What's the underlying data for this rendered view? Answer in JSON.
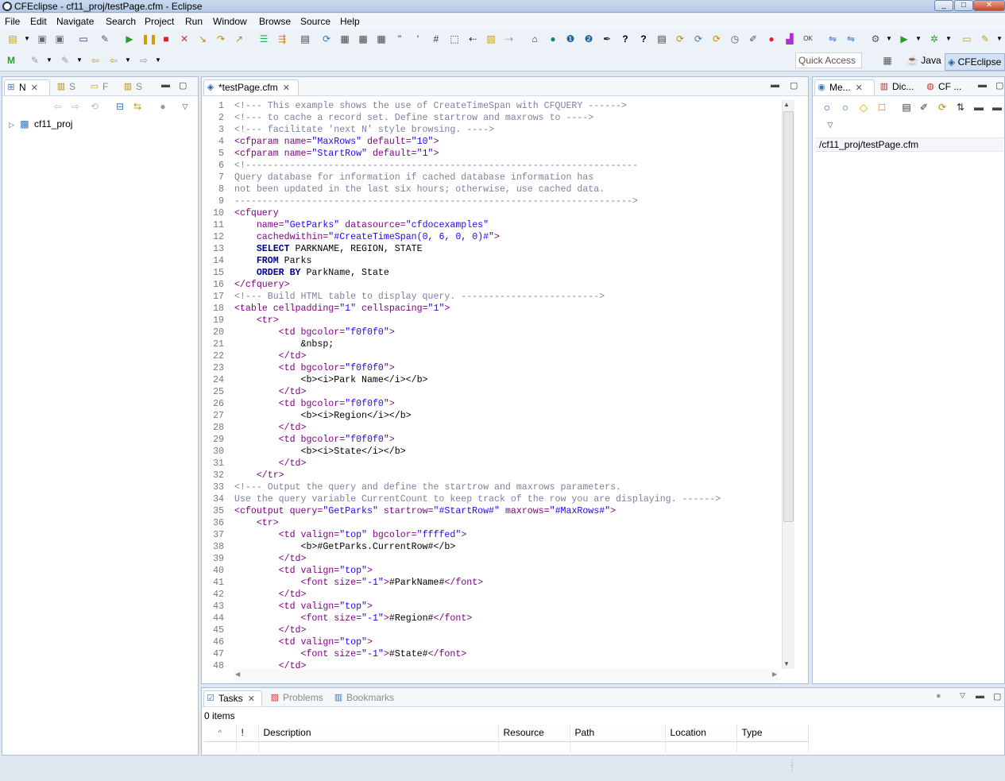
{
  "window": {
    "title": "CFEclipse - cf11_proj/testPage.cfm - Eclipse",
    "min": "_",
    "max": "□",
    "close": "✕"
  },
  "menu": [
    "File",
    "Edit",
    "Navigate",
    "Search",
    "Project",
    "Run",
    "Window",
    "Browse",
    "Source",
    "Help"
  ],
  "quick_access": {
    "placeholder": "Quick Access"
  },
  "perspectives": {
    "java": "Java",
    "cfeclipse": "CFEclipse"
  },
  "left_panel": {
    "tabs": [
      {
        "label": "N",
        "icon": "navigator-icon"
      },
      {
        "label": "S",
        "icon": "library-icon"
      },
      {
        "label": "F",
        "icon": "folder-icon"
      },
      {
        "label": "S",
        "icon": "library-icon"
      }
    ],
    "tree": [
      {
        "label": "cf11_proj",
        "icon": "project-icon"
      }
    ]
  },
  "editor": {
    "tab_label": "*testPage.cfm",
    "lines": [
      [
        [
          "cm",
          "<!--- This example shows the use of CreateTimeSpan with CFQUERY ------>"
        ]
      ],
      [
        [
          "cm",
          "<!--- to cache a record set. Define startrow and maxrows to ---->"
        ]
      ],
      [
        [
          "cm",
          "<!--- facilitate 'next N' style browsing. ---->"
        ]
      ],
      [
        [
          "tg",
          "<cfparam "
        ],
        [
          "at",
          "name="
        ],
        [
          "st",
          "\"MaxRows\""
        ],
        [
          "at",
          " default="
        ],
        [
          "st",
          "\"10\""
        ],
        [
          "tg",
          ">"
        ]
      ],
      [
        [
          "tg",
          "<cfparam "
        ],
        [
          "at",
          "name="
        ],
        [
          "st",
          "\"StartRow\""
        ],
        [
          "at",
          " default="
        ],
        [
          "st",
          "\"1\""
        ],
        [
          "tg",
          ">"
        ]
      ],
      [
        [
          "cm",
          "<!-----------------------------------------------------------------------"
        ]
      ],
      [
        [
          "cm",
          "Query database for information if cached database information has"
        ]
      ],
      [
        [
          "cm",
          "not been updated in the last six hours; otherwise, use cached data."
        ]
      ],
      [
        [
          "cm",
          "------------------------------------------------------------------------>"
        ]
      ],
      [
        [
          "tg",
          "<cfquery"
        ]
      ],
      [
        [
          "tx",
          "    "
        ],
        [
          "at",
          "name="
        ],
        [
          "st",
          "\"GetParks\""
        ],
        [
          "at",
          " datasource="
        ],
        [
          "st",
          "\"cfdocexamples\""
        ]
      ],
      [
        [
          "tx",
          "    "
        ],
        [
          "at",
          "cachedwithin="
        ],
        [
          "st",
          "\"#CreateTimeSpan(0, 6, 0, 0)#\""
        ],
        [
          "tg",
          ">"
        ]
      ],
      [
        [
          "tx",
          "    "
        ],
        [
          "kw",
          "SELECT"
        ],
        [
          "tx",
          " PARKNAME, REGION, STATE"
        ]
      ],
      [
        [
          "tx",
          "    "
        ],
        [
          "kw",
          "FROM"
        ],
        [
          "tx",
          " Parks"
        ]
      ],
      [
        [
          "tx",
          "    "
        ],
        [
          "kw",
          "ORDER BY"
        ],
        [
          "tx",
          " ParkName, State"
        ]
      ],
      [
        [
          "tg",
          "</cfquery>"
        ]
      ],
      [
        [
          "cm",
          "<!--- Build HTML table to display query. ------------------------->"
        ]
      ],
      [
        [
          "tg",
          "<table "
        ],
        [
          "at",
          "cellpadding="
        ],
        [
          "st",
          "\"1\""
        ],
        [
          "at",
          " cellspacing="
        ],
        [
          "st",
          "\"1\""
        ],
        [
          "tg",
          ">"
        ]
      ],
      [
        [
          "tx",
          "    "
        ],
        [
          "tg",
          "<tr>"
        ]
      ],
      [
        [
          "tx",
          "        "
        ],
        [
          "tg",
          "<td "
        ],
        [
          "at",
          "bgcolor="
        ],
        [
          "st",
          "\"f0f0f0\""
        ],
        [
          "tg",
          ">"
        ]
      ],
      [
        [
          "tx",
          "            &nbsp;"
        ]
      ],
      [
        [
          "tx",
          "        "
        ],
        [
          "tg",
          "</td>"
        ]
      ],
      [
        [
          "tx",
          "        "
        ],
        [
          "tg",
          "<td "
        ],
        [
          "at",
          "bgcolor="
        ],
        [
          "st",
          "\"f0f0f0\""
        ],
        [
          "tg",
          ">"
        ]
      ],
      [
        [
          "tx",
          "            <b><i>Park Name</i></b>"
        ]
      ],
      [
        [
          "tx",
          "        "
        ],
        [
          "tg",
          "</td>"
        ]
      ],
      [
        [
          "tx",
          "        "
        ],
        [
          "tg",
          "<td "
        ],
        [
          "at",
          "bgcolor="
        ],
        [
          "st",
          "\"f0f0f0\""
        ],
        [
          "tg",
          ">"
        ]
      ],
      [
        [
          "tx",
          "            <b><i>Region</i></b>"
        ]
      ],
      [
        [
          "tx",
          "        "
        ],
        [
          "tg",
          "</td>"
        ]
      ],
      [
        [
          "tx",
          "        "
        ],
        [
          "tg",
          "<td "
        ],
        [
          "at",
          "bgcolor="
        ],
        [
          "st",
          "\"f0f0f0\""
        ],
        [
          "tg",
          ">"
        ]
      ],
      [
        [
          "tx",
          "            <b><i>State</i></b>"
        ]
      ],
      [
        [
          "tx",
          "        "
        ],
        [
          "tg",
          "</td>"
        ]
      ],
      [
        [
          "tx",
          "    "
        ],
        [
          "tg",
          "</tr>"
        ]
      ],
      [
        [
          "cm",
          "<!--- Output the query and define the startrow and maxrows parameters."
        ]
      ],
      [
        [
          "cm",
          "Use the query variable CurrentCount to keep track of the row you are displaying. ------>"
        ]
      ],
      [
        [
          "tg",
          "<cfoutput "
        ],
        [
          "at",
          "query="
        ],
        [
          "st",
          "\"GetParks\""
        ],
        [
          "at",
          " startrow="
        ],
        [
          "st",
          "\"#StartRow#\""
        ],
        [
          "at",
          " maxrows="
        ],
        [
          "st",
          "\"#MaxRows#\""
        ],
        [
          "tg",
          ">"
        ]
      ],
      [
        [
          "tx",
          "    "
        ],
        [
          "tg",
          "<tr>"
        ]
      ],
      [
        [
          "tx",
          "        "
        ],
        [
          "tg",
          "<td "
        ],
        [
          "at",
          "valign="
        ],
        [
          "st",
          "\"top\""
        ],
        [
          "at",
          " bgcolor="
        ],
        [
          "st",
          "\"ffffed\""
        ],
        [
          "tg",
          ">"
        ]
      ],
      [
        [
          "tx",
          "            <b>#GetParks.CurrentRow#</b>"
        ]
      ],
      [
        [
          "tx",
          "        "
        ],
        [
          "tg",
          "</td>"
        ]
      ],
      [
        [
          "tx",
          "        "
        ],
        [
          "tg",
          "<td "
        ],
        [
          "at",
          "valign="
        ],
        [
          "st",
          "\"top\""
        ],
        [
          "tg",
          ">"
        ]
      ],
      [
        [
          "tx",
          "            "
        ],
        [
          "tg",
          "<font "
        ],
        [
          "at",
          "size="
        ],
        [
          "st",
          "\"-1\""
        ],
        [
          "tg",
          ">"
        ],
        [
          "tx",
          "#ParkName#"
        ],
        [
          "tg",
          "</font>"
        ]
      ],
      [
        [
          "tx",
          "        "
        ],
        [
          "tg",
          "</td>"
        ]
      ],
      [
        [
          "tx",
          "        "
        ],
        [
          "tg",
          "<td "
        ],
        [
          "at",
          "valign="
        ],
        [
          "st",
          "\"top\""
        ],
        [
          "tg",
          ">"
        ]
      ],
      [
        [
          "tx",
          "            "
        ],
        [
          "tg",
          "<font "
        ],
        [
          "at",
          "size="
        ],
        [
          "st",
          "\"-1\""
        ],
        [
          "tg",
          ">"
        ],
        [
          "tx",
          "#Region#"
        ],
        [
          "tg",
          "</font>"
        ]
      ],
      [
        [
          "tx",
          "        "
        ],
        [
          "tg",
          "</td>"
        ]
      ],
      [
        [
          "tx",
          "        "
        ],
        [
          "tg",
          "<td "
        ],
        [
          "at",
          "valign="
        ],
        [
          "st",
          "\"top\""
        ],
        [
          "tg",
          ">"
        ]
      ],
      [
        [
          "tx",
          "            "
        ],
        [
          "tg",
          "<font "
        ],
        [
          "at",
          "size="
        ],
        [
          "st",
          "\"-1\""
        ],
        [
          "tg",
          ">"
        ],
        [
          "tx",
          "#State#"
        ],
        [
          "tg",
          "</font>"
        ]
      ],
      [
        [
          "tx",
          "        "
        ],
        [
          "tg",
          "</td>"
        ]
      ]
    ]
  },
  "right_panel": {
    "tabs": [
      {
        "label": "Me...",
        "icon": "methods-icon"
      },
      {
        "label": "Dic...",
        "icon": "dictionary-icon"
      },
      {
        "label": "CF ...",
        "icon": "cf-icon"
      }
    ],
    "path": "/cf11_proj/testPage.cfm"
  },
  "bottom_panel": {
    "tabs": [
      {
        "label": "Tasks",
        "icon": "tasks-icon"
      },
      {
        "label": "Problems",
        "icon": "problems-icon"
      },
      {
        "label": "Bookmarks",
        "icon": "bookmarks-icon"
      }
    ],
    "count": "0 items",
    "columns": [
      "!",
      "Description",
      "Resource",
      "Path",
      "Location",
      "Type"
    ]
  }
}
